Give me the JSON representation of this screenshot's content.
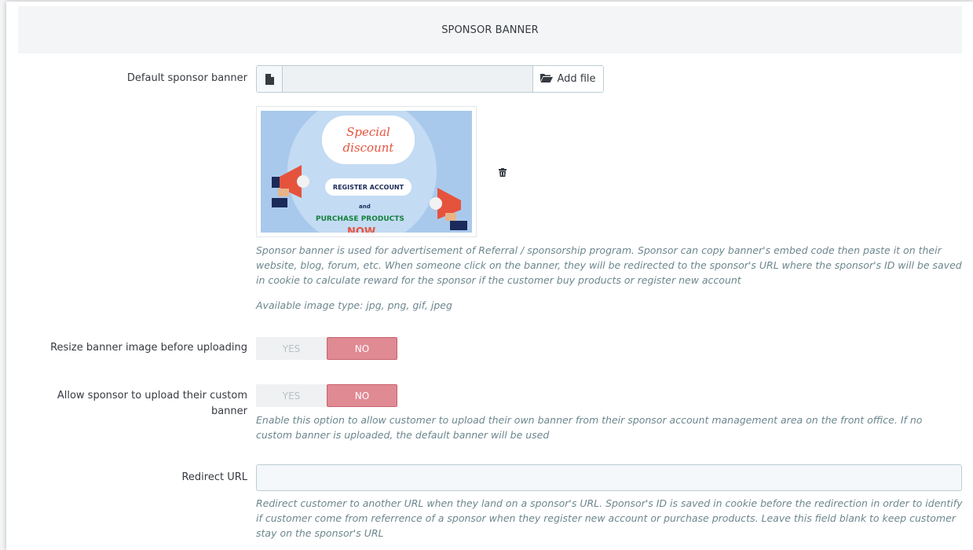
{
  "panel": {
    "title": "SPONSOR BANNER"
  },
  "default_banner": {
    "label": "Default sponsor banner",
    "file_value": "",
    "add_file_label": "Add file",
    "preview": {
      "line1": "Special",
      "line2": "discount",
      "register": "REGISTER ACCOUNT",
      "and": "and",
      "purchase": "PURCHASE PRODUCTS",
      "now": "NOW"
    },
    "help": "Sponsor banner is used for advertisement of Referral / sponsorship program. Sponsor can copy banner's embed code then paste it on their website, blog, forum, etc. When someone click on the banner, they will be redirected to the sponsor's URL where the sponsor's ID will be saved in cookie to calculate reward for the sponsor if the customer buy products or register new account",
    "available_types": "Available image type: jpg, png, gif, jpeg"
  },
  "resize": {
    "label": "Resize banner image before uploading",
    "yes": "YES",
    "no": "NO",
    "selected": "NO"
  },
  "custom_banner": {
    "label": "Allow sponsor to upload their custom banner",
    "yes": "YES",
    "no": "NO",
    "selected": "NO",
    "help": "Enable this option to allow customer to upload their own banner from their sponsor account management area on the front office. If no custom banner is uploaded, the default banner will be used"
  },
  "redirect": {
    "label": "Redirect URL",
    "value": "",
    "help": "Redirect customer to another URL when they land on a sponsor's URL. Sponsor's ID is saved in cookie before the redirection in order to identify if customer come from referrence of a sponsor when they register new account or purchase products. Leave this field blank to keep customer stay on the sponsor's URL"
  },
  "colors": {
    "toggle_no": "#e08a93",
    "help_text": "#6c868e",
    "header_bg": "#f4f5f6"
  }
}
